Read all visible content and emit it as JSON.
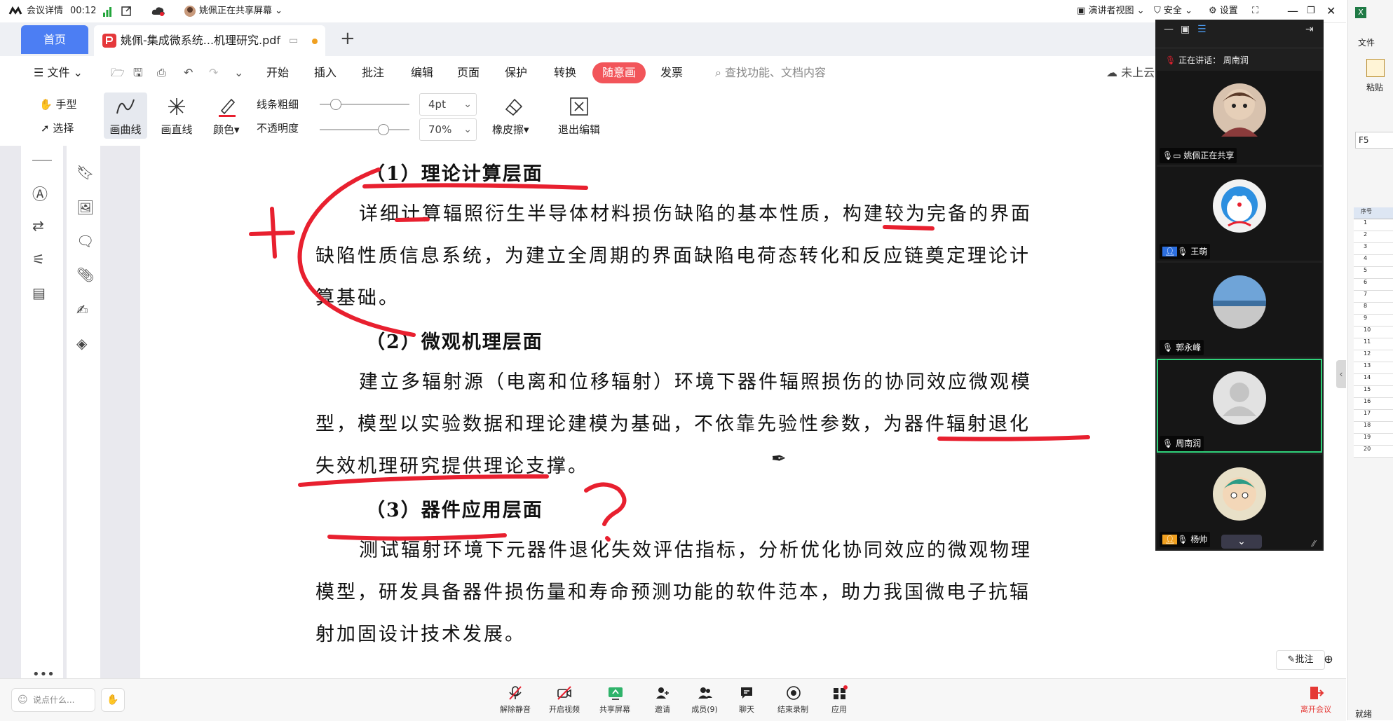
{
  "meeting": {
    "details_label": "会议详情",
    "timer": "00:12",
    "sharing_status": "姚佩正在共享屏幕",
    "presenter_view": "演讲者视图",
    "security": "安全",
    "settings": "设置"
  },
  "tabs": {
    "home": "首页",
    "document": "姚佩-集成微系统...机理研究.pdf"
  },
  "menu": {
    "file": "文件",
    "items": [
      "开始",
      "插入",
      "批注",
      "编辑",
      "页面",
      "保护",
      "转换",
      "随意画",
      "发票"
    ],
    "search_placeholder": "查找功能、文档内容",
    "cloud": "未上云"
  },
  "pen_toolbar": {
    "hand": "手型",
    "select": "选择",
    "curve": "画曲线",
    "line": "画直线",
    "color": "颜色",
    "stroke_label": "线条粗细",
    "opacity_label": "不透明度",
    "stroke_value": "4pt",
    "opacity_value": "70%",
    "eraser": "橡皮擦",
    "exit": "退出编辑",
    "stroke_fraction": 0.17,
    "opacity_fraction": 0.7
  },
  "document": {
    "h1": "（1）理论计算层面",
    "p1_lines": [
      "详细计算辐照衍生半导体材料损伤缺陷的基本性质，构建较为完备的界面",
      "缺陷性质信息系统，为建立全周期的界面缺陷电荷态转化和反应链奠定理论计",
      "算基础。"
    ],
    "h2": "（2）微观机理层面",
    "p2_lines": [
      "建立多辐射源（电离和位移辐射）环境下器件辐照损伤的协同效应微观模",
      "型，模型以实验数据和理论建模为基础，不依靠先验性参数，为器件辐射退化",
      "失效机理研究提供理论支撑。"
    ],
    "h3": "（3）器件应用层面",
    "p3_lines": [
      "测试辐射环境下元器件退化失效评估指标，分析优化协同效应的微观物理",
      "模型，研发具备器件损伤量和寿命预测功能的软件范本，助力我国微电子抗辐",
      "射加固设计技术发展。"
    ]
  },
  "participants": {
    "speaking_prefix": "正在讲话：",
    "speaking_name": "周南润",
    "list": [
      {
        "name": "姚佩正在共享"
      },
      {
        "name": "王萌"
      },
      {
        "name": "郭永峰"
      },
      {
        "name": "周南润"
      },
      {
        "name": "杨帅"
      }
    ]
  },
  "annotate": {
    "comment": "批注"
  },
  "bottom_bar": {
    "chat_placeholder": "说点什么...",
    "unmute": "解除静音",
    "start_video": "开启视频",
    "share_screen": "共享屏幕",
    "invite": "邀请",
    "members": "成员(9)",
    "chat": "聊天",
    "end_record": "结束录制",
    "apps": "应用",
    "leave": "离开会议"
  },
  "excel": {
    "file": "文件",
    "paste": "粘贴",
    "cell_ref": "F5",
    "status": "就绪",
    "header": "序号",
    "rows": [
      "1",
      "2",
      "3",
      "4",
      "5",
      "6",
      "7",
      "8",
      "9",
      "10",
      "11",
      "12",
      "13",
      "14",
      "15",
      "16",
      "17",
      "18",
      "19",
      "20"
    ]
  },
  "colors": {
    "accent_blue": "#4c7ef3",
    "annotation_red": "#e8202f",
    "menu_active": "#f2555a",
    "active_speaker": "#2fd27a",
    "leave_red": "#e53935"
  }
}
